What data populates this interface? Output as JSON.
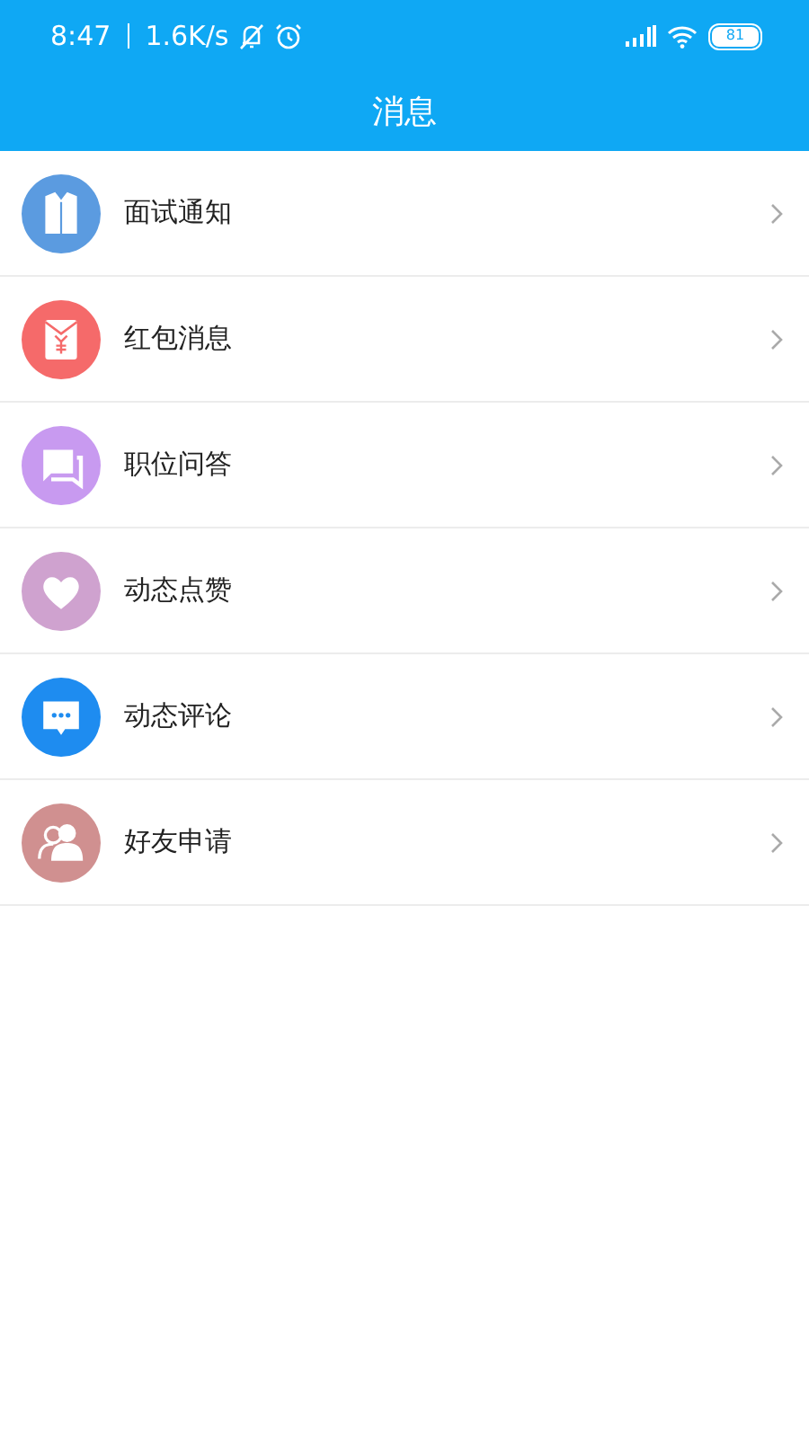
{
  "status_bar": {
    "time": "8:47",
    "speed": "1.6K/s",
    "battery": "81"
  },
  "title": "消息",
  "items": [
    {
      "label": "面试通知",
      "kind": "shirt",
      "color": "#5b9be0"
    },
    {
      "label": "红包消息",
      "kind": "envelope",
      "color": "#f56a6a"
    },
    {
      "label": "职位问答",
      "kind": "chat",
      "color": "#c89af0"
    },
    {
      "label": "动态点赞",
      "kind": "heart",
      "color": "#cfa2cf"
    },
    {
      "label": "动态评论",
      "kind": "comment",
      "color": "#1e8cf0"
    },
    {
      "label": "好友申请",
      "kind": "friends",
      "color": "#d09090"
    }
  ]
}
